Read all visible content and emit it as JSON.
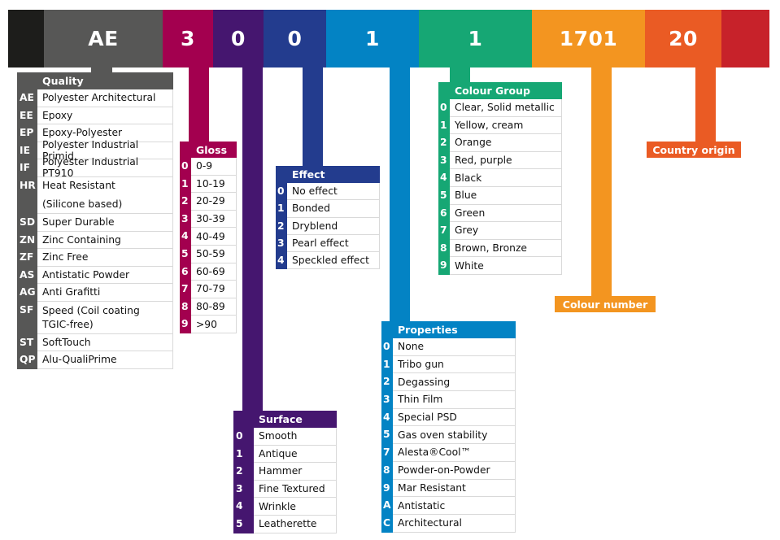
{
  "colors": {
    "black": "#1d1d1b",
    "quality": "#575756",
    "gloss": "#a3004f",
    "surface": "#45166f",
    "effect": "#233c8e",
    "properties": "#0383c4",
    "colour_group": "#16a774",
    "colour_number": "#f39520",
    "country_origin": "#ea5b24",
    "end": "#c7222a"
  },
  "code_band": {
    "segments": [
      {
        "id": "black",
        "text": ""
      },
      {
        "id": "quality",
        "text": "AE"
      },
      {
        "id": "gloss",
        "text": "3"
      },
      {
        "id": "surface",
        "text": "0"
      },
      {
        "id": "effect",
        "text": "0"
      },
      {
        "id": "properties",
        "text": "1"
      },
      {
        "id": "colour_group",
        "text": "1"
      },
      {
        "id": "colour_number",
        "text": "1701"
      },
      {
        "id": "country_origin",
        "text": "20"
      },
      {
        "id": "end",
        "text": ""
      }
    ]
  },
  "quality": {
    "title": "Quality",
    "rows": [
      {
        "code": "AE",
        "label": "Polyester Architectural"
      },
      {
        "code": "EE",
        "label": "Epoxy"
      },
      {
        "code": "EP",
        "label": "Epoxy-Polyester"
      },
      {
        "code": "IE",
        "label": "Polyester Industrial Primid"
      },
      {
        "code": "IF",
        "label": "Polyester Industrial PT910"
      },
      {
        "code": "HR",
        "label": "Heat Resistant"
      },
      {
        "code": "",
        "label": "(Silicone based)"
      },
      {
        "code": "SD",
        "label": "Super Durable"
      },
      {
        "code": "ZN",
        "label": "Zinc Containing"
      },
      {
        "code": "ZF",
        "label": "Zinc Free"
      },
      {
        "code": "AS",
        "label": "Antistatic Powder"
      },
      {
        "code": "AG",
        "label": "Anti Grafitti"
      },
      {
        "code": "SF",
        "label": "Speed  (Coil coating TGIC-free)"
      },
      {
        "code": "ST",
        "label": "SoftTouch"
      },
      {
        "code": "QP",
        "label": "Alu-QualiPrime"
      }
    ]
  },
  "gloss": {
    "title": "Gloss",
    "rows": [
      {
        "code": "0",
        "label": "0-9"
      },
      {
        "code": "1",
        "label": "10-19"
      },
      {
        "code": "2",
        "label": "20-29"
      },
      {
        "code": "3",
        "label": "30-39"
      },
      {
        "code": "4",
        "label": "40-49"
      },
      {
        "code": "5",
        "label": "50-59"
      },
      {
        "code": "6",
        "label": "60-69"
      },
      {
        "code": "7",
        "label": "70-79"
      },
      {
        "code": "8",
        "label": "80-89"
      },
      {
        "code": "9",
        "label": ">90"
      }
    ]
  },
  "effect": {
    "title": "Effect",
    "rows": [
      {
        "code": "0",
        "label": "No effect"
      },
      {
        "code": "1",
        "label": "Bonded"
      },
      {
        "code": "2",
        "label": "Dryblend"
      },
      {
        "code": "3",
        "label": "Pearl effect"
      },
      {
        "code": "4",
        "label": "Speckled effect"
      }
    ]
  },
  "surface": {
    "title": "Surface",
    "rows": [
      {
        "code": "0",
        "label": "Smooth"
      },
      {
        "code": "1",
        "label": "Antique"
      },
      {
        "code": "2",
        "label": "Hammer"
      },
      {
        "code": "3",
        "label": "Fine Textured"
      },
      {
        "code": "4",
        "label": "Wrinkle"
      },
      {
        "code": "5",
        "label": "Leatherette"
      }
    ]
  },
  "properties": {
    "title": "Properties",
    "rows": [
      {
        "code": "0",
        "label": "None"
      },
      {
        "code": "1",
        "label": "Tribo gun"
      },
      {
        "code": "2",
        "label": "Degassing"
      },
      {
        "code": "3",
        "label": "Thin Film"
      },
      {
        "code": "4",
        "label": "Special PSD"
      },
      {
        "code": "5",
        "label": "Gas oven stability"
      },
      {
        "code": "7",
        "label": "Alesta®Cool™"
      },
      {
        "code": "8",
        "label": "Powder-on-Powder"
      },
      {
        "code": "9",
        "label": "Mar Resistant"
      },
      {
        "code": "A",
        "label": "Antistatic"
      },
      {
        "code": "C",
        "label": "Architectural"
      }
    ]
  },
  "colour_group": {
    "title": "Colour Group",
    "rows": [
      {
        "code": "0",
        "label": "Clear, Solid metallic"
      },
      {
        "code": "1",
        "label": "Yellow, cream"
      },
      {
        "code": "2",
        "label": "Orange"
      },
      {
        "code": "3",
        "label": "Red, purple"
      },
      {
        "code": "4",
        "label": "Black"
      },
      {
        "code": "5",
        "label": "Blue"
      },
      {
        "code": "6",
        "label": "Green"
      },
      {
        "code": "7",
        "label": "Grey"
      },
      {
        "code": "8",
        "label": "Brown, Bronze"
      },
      {
        "code": "9",
        "label": "White"
      }
    ]
  },
  "colour_number": {
    "title": "Colour number"
  },
  "country_origin": {
    "title": "Country origin"
  }
}
